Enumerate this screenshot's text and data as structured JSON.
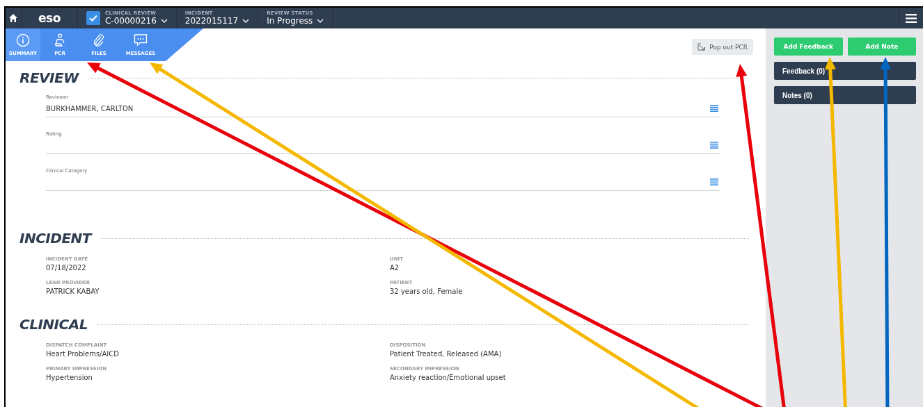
{
  "topbar": {
    "logo": "eso",
    "selectors": [
      {
        "kind": "checkbox",
        "checked": true,
        "label": "CLINICAL REVIEW",
        "value": "C-00000216"
      },
      {
        "kind": "plain",
        "label": "INCIDENT",
        "value": "2022015117"
      },
      {
        "kind": "plain",
        "label": "REVIEW STATUS",
        "value": "In Progress"
      }
    ]
  },
  "tabs": [
    {
      "label": "SUMMARY",
      "selected": true
    },
    {
      "label": "PCR",
      "selected": false
    },
    {
      "label": "FILES",
      "selected": false
    },
    {
      "label": "MESSAGES",
      "selected": false
    }
  ],
  "pop_out_button": "Pop out PCR",
  "sections": [
    {
      "title": "REVIEW",
      "kind": "form",
      "fields": [
        {
          "label": "Reviewer",
          "value": "BURKHAMMER, CARLTON"
        },
        {
          "label": "Rating"
        },
        {
          "label": "Clinical Category"
        }
      ]
    },
    {
      "title": "INCIDENT",
      "kind": "grid",
      "fields": [
        {
          "label": "INCIDENT DATE",
          "value": "07/18/2022"
        },
        {
          "label": "UNIT",
          "value": "A2"
        },
        {
          "label": "LEAD PROVIDER",
          "value": "PATRICK KABAY"
        },
        {
          "label": "PATIENT",
          "value": "32 years old, Female"
        }
      ]
    },
    {
      "title": "CLINICAL",
      "kind": "grid",
      "fields": [
        {
          "label": "DISPATCH COMPLAINT",
          "value": "Heart Problems/AICD"
        },
        {
          "label": "DISPOSITION",
          "value": "Patient Treated, Released (AMA)"
        },
        {
          "label": "PRIMARY IMPRESSION",
          "value": "Hypertension"
        },
        {
          "label": "SECONDARY IMPRESSION",
          "value": "Anxiety reaction/Emotional upset"
        }
      ]
    }
  ],
  "sidebar": {
    "buttons": [
      "Add Feedback",
      "Add Note"
    ],
    "panels": [
      "Feedback (0)",
      "Notes (0)"
    ]
  }
}
